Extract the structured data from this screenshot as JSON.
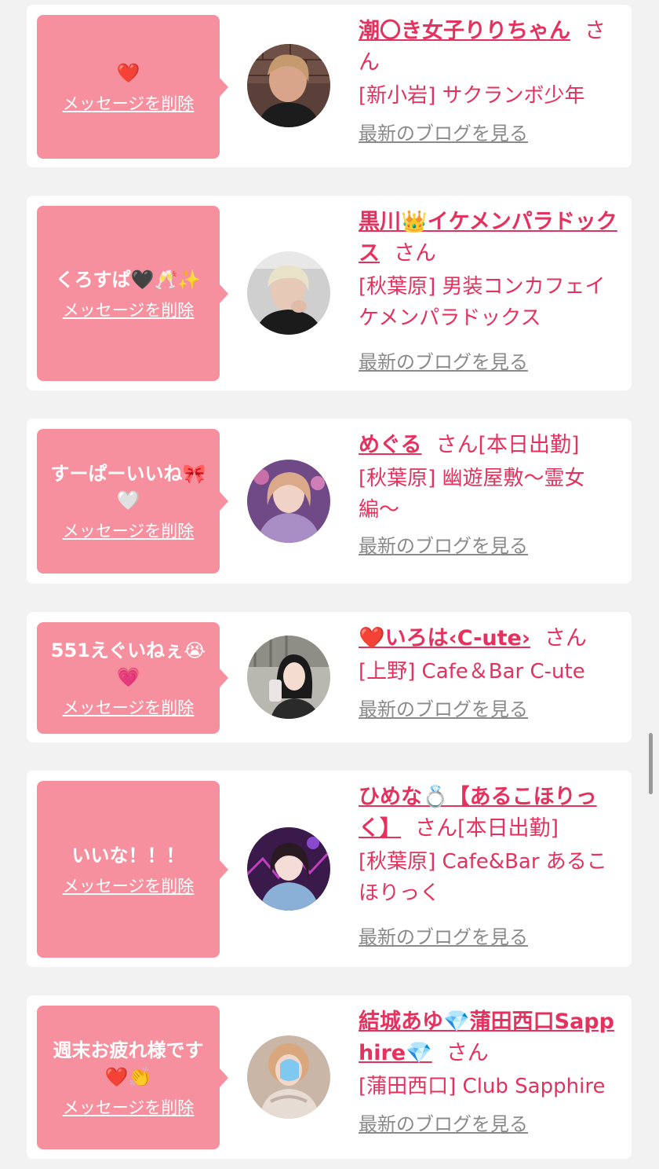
{
  "delete_label": "メッセージを削除",
  "blog_label": "最新のブログを見る",
  "san_label": "さん",
  "colors": {
    "accent": "#e5315d",
    "bubble": "#f7909e",
    "muted": "#8a8a8a"
  },
  "cards": [
    {
      "message": "❤️",
      "name": "潮〇き女子りりちゃん",
      "status": "",
      "shop": "[新小岩] サクランボ少年",
      "avatar": "woman-dark-outfit"
    },
    {
      "message": "くろすぱ🖤🥂✨",
      "name": "黒川👑イケメンパラドックス",
      "status": "",
      "shop": "[秋葉原] 男装コンカフェイケメンパラドックス",
      "avatar": "blond-host"
    },
    {
      "message": "すーぱーいいね🎀🤍",
      "name": "めぐる",
      "status": "[本日出勤]",
      "shop": "[秋葉原] 幽遊屋敷〜霊女編〜",
      "avatar": "purple-dress-girl"
    },
    {
      "message": "551えぐいねぇ😭💗",
      "name": "❤️いろは‹C-ute›",
      "status": "",
      "shop": "[上野] Cafe＆Bar C-ute",
      "avatar": "mirror-selfie-girl"
    },
    {
      "message": "いいな！！！",
      "name": "ひめな💍【あるこほりっく】",
      "status": "[本日出勤]",
      "shop": "[秋葉原] Cafe&Bar あるこほりっく",
      "avatar": "neon-idol-girl"
    },
    {
      "message": "週末お疲れ様です❤️👏",
      "name": "結城あゆ💎蒲田西口Sapphire💎",
      "status": "",
      "shop": "[蒲田西口] Club Sapphire",
      "avatar": "blurred-face-girl"
    }
  ]
}
